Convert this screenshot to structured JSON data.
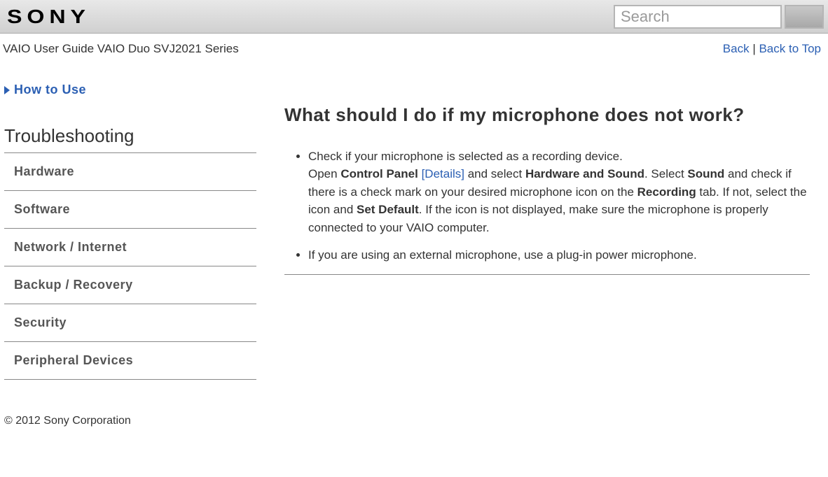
{
  "header": {
    "logo": "SONY",
    "search_placeholder": "Search"
  },
  "subheader": {
    "title": "VAIO User Guide VAIO Duo SVJ2021 Series",
    "back": "Back",
    "sep": " | ",
    "back_to_top": "Back to Top"
  },
  "sidebar": {
    "howto": "How to Use",
    "section": "Troubleshooting",
    "items": [
      {
        "label": "Hardware"
      },
      {
        "label": "Software"
      },
      {
        "label": "Network / Internet"
      },
      {
        "label": "Backup / Recovery"
      },
      {
        "label": "Security"
      },
      {
        "label": "Peripheral Devices"
      }
    ]
  },
  "article": {
    "title": "What should I do if my microphone does not work?",
    "b1_line1": "Check if your microphone is selected as a recording device.",
    "b1_open": "Open ",
    "b1_cp": "Control Panel",
    "b1_sp1": " ",
    "b1_details": "[Details]",
    "b1_and_select": " and select ",
    "b1_hw": "Hardware and Sound",
    "b1_select": ". Select ",
    "b1_sound": "Sound",
    "b1_mid": " and check if there is a check mark on your desired microphone icon on the ",
    "b1_rec": "Recording",
    "b1_tab": " tab. If not, select the icon and ",
    "b1_setdef": "Set Default",
    "b1_tail": ". If the icon is not displayed, make sure the microphone is properly connected to your VAIO computer.",
    "b2": "If you are using an external microphone, use a plug-in power microphone."
  },
  "footer": {
    "copyright": "© 2012 Sony Corporation"
  }
}
